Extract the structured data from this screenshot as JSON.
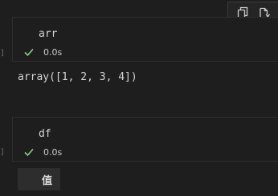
{
  "toolbar": {
    "icons": [
      "copy-icon",
      "clear-output-icon"
    ]
  },
  "cells": [
    {
      "code": "arr",
      "status": "0.0s",
      "gutter": "]"
    },
    {
      "code": "df",
      "status": "0.0s",
      "gutter": "]"
    }
  ],
  "output": {
    "text": "array([1, 2, 3, 4])"
  },
  "table": {
    "header": "值"
  },
  "colors": {
    "background": "#1e1e1e",
    "success": "#89d185",
    "text": "#cccccc"
  }
}
